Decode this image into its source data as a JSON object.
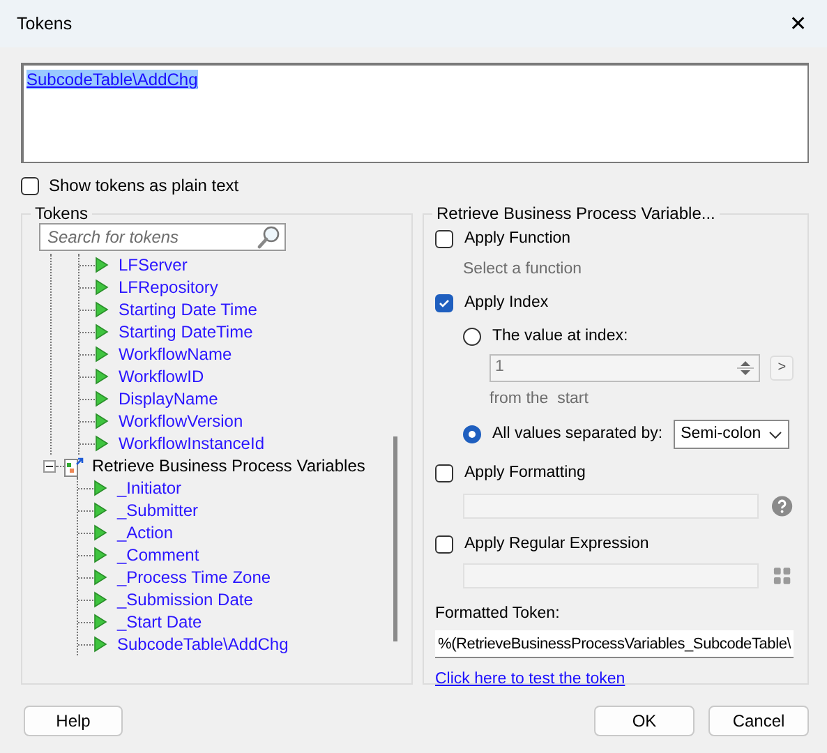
{
  "window": {
    "title": "Tokens",
    "close": "✕"
  },
  "token_text": {
    "value": "SubcodeTable\\AddChg",
    "selected": true
  },
  "plain_text_option": {
    "label": "Show tokens as plain text",
    "checked": false
  },
  "tokens_panel": {
    "title": "Tokens",
    "search": {
      "placeholder": "Search for tokens"
    },
    "tree": [
      {
        "kind": "cut-off-group",
        "children": [
          {
            "label": "LFServer"
          },
          {
            "label": "LFRepository"
          },
          {
            "label": "Starting Date Time"
          },
          {
            "label": "Starting DateTime"
          },
          {
            "label": "WorkflowName"
          },
          {
            "label": "WorkflowID"
          },
          {
            "label": "DisplayName"
          },
          {
            "label": "WorkflowVersion"
          },
          {
            "label": "WorkflowInstanceId"
          }
        ]
      },
      {
        "kind": "group",
        "label": "Retrieve Business Process Variables",
        "expanded": true,
        "children": [
          {
            "label": "_Initiator"
          },
          {
            "label": "_Submitter"
          },
          {
            "label": "_Action"
          },
          {
            "label": "_Comment"
          },
          {
            "label": "_Process Time Zone"
          },
          {
            "label": "_Submission Date"
          },
          {
            "label": "_Start Date"
          },
          {
            "label": "SubcodeTable\\AddChg"
          }
        ]
      }
    ]
  },
  "options_panel": {
    "title": "Retrieve Business Process Variable...",
    "apply_function": {
      "label": "Apply Function",
      "checked": false,
      "hint": "Select a function"
    },
    "apply_index": {
      "label": "Apply Index",
      "checked": true,
      "at_index": {
        "label": "The value at index:",
        "selected": false,
        "value": "1",
        "disabled": true,
        "go": ">",
        "note": "from the  start"
      },
      "all_values": {
        "label": "All values separated by:",
        "selected": true,
        "separator": "Semi-colon"
      }
    },
    "apply_formatting": {
      "label": "Apply Formatting",
      "checked": false
    },
    "apply_regex": {
      "label": "Apply Regular Expression",
      "checked": false
    },
    "formatted_token": {
      "label": "Formatted Token:",
      "value": "%(RetrieveBusinessProcessVariables_SubcodeTable\\"
    },
    "test_link": "Click here to test the token"
  },
  "buttons": {
    "help": "Help",
    "ok": "OK",
    "cancel": "Cancel"
  }
}
